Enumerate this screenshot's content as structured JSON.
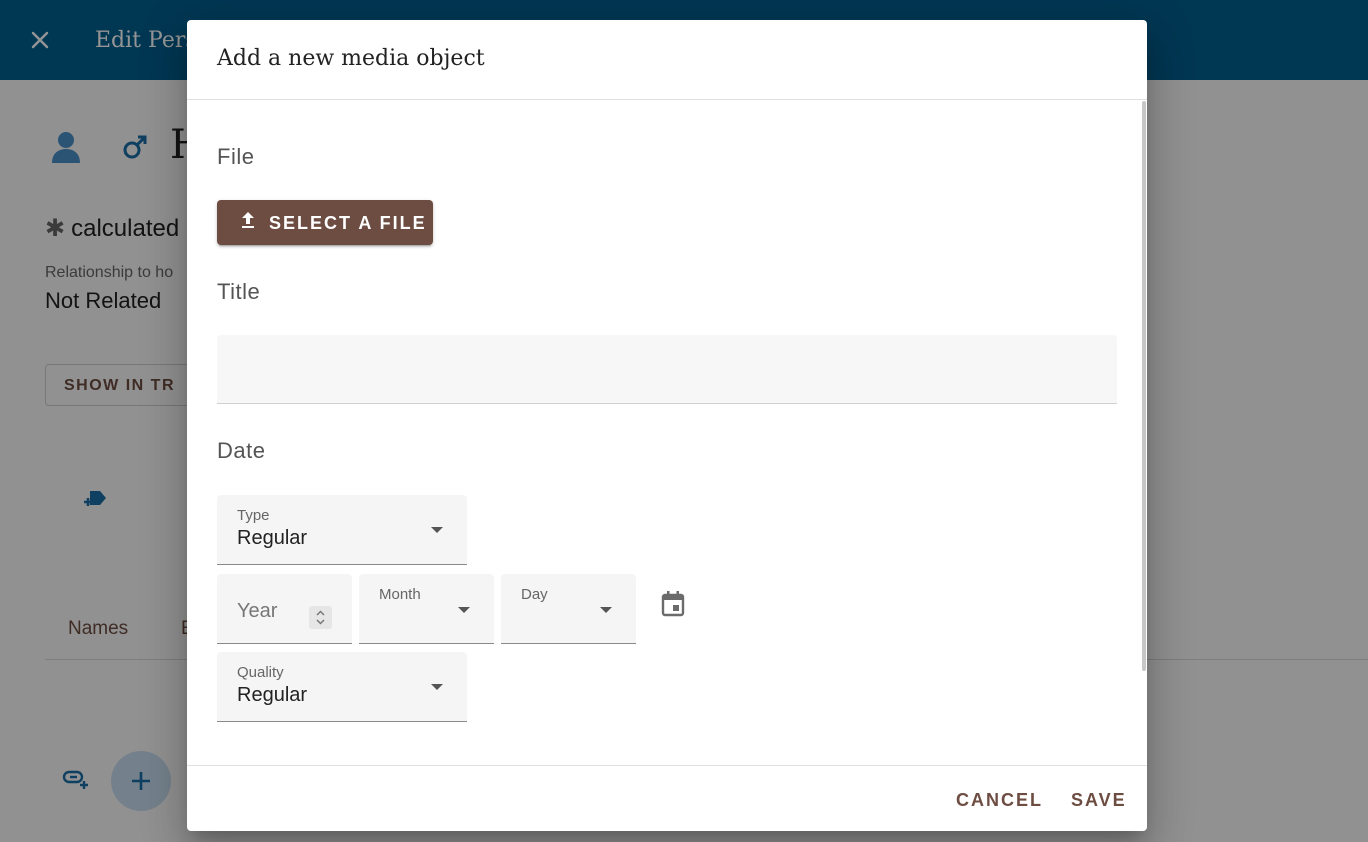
{
  "colors": {
    "app_bar": "#005f8f",
    "accent_brown": "#6d4c41",
    "icon_blue": "#1a6ea8",
    "fab_bg": "#c8dcef"
  },
  "background": {
    "app_bar_title": "Edit Pers",
    "close_icon": "close-icon",
    "person_name_initial": "H",
    "calculated_label": "calculated",
    "relationship_label": "Relationship to ho",
    "relationship_value": "Not Related",
    "show_in_tree_label": "SHOW IN TR",
    "tabs": [
      "Names",
      "E"
    ]
  },
  "dialog": {
    "title": "Add a new media object",
    "file": {
      "section_label": "File",
      "select_button_label": "SELECT A FILE",
      "button_icon": "upload-icon"
    },
    "title_field": {
      "section_label": "Title",
      "value": ""
    },
    "date": {
      "section_label": "Date",
      "type": {
        "label": "Type",
        "value": "Regular"
      },
      "year": {
        "placeholder": "Year"
      },
      "month": {
        "label": "Month",
        "value": ""
      },
      "day": {
        "label": "Day",
        "value": ""
      },
      "calendar_icon": "calendar-icon",
      "quality": {
        "label": "Quality",
        "value": "Regular"
      }
    },
    "actions": {
      "cancel_label": "CANCEL",
      "save_label": "SAVE"
    }
  }
}
